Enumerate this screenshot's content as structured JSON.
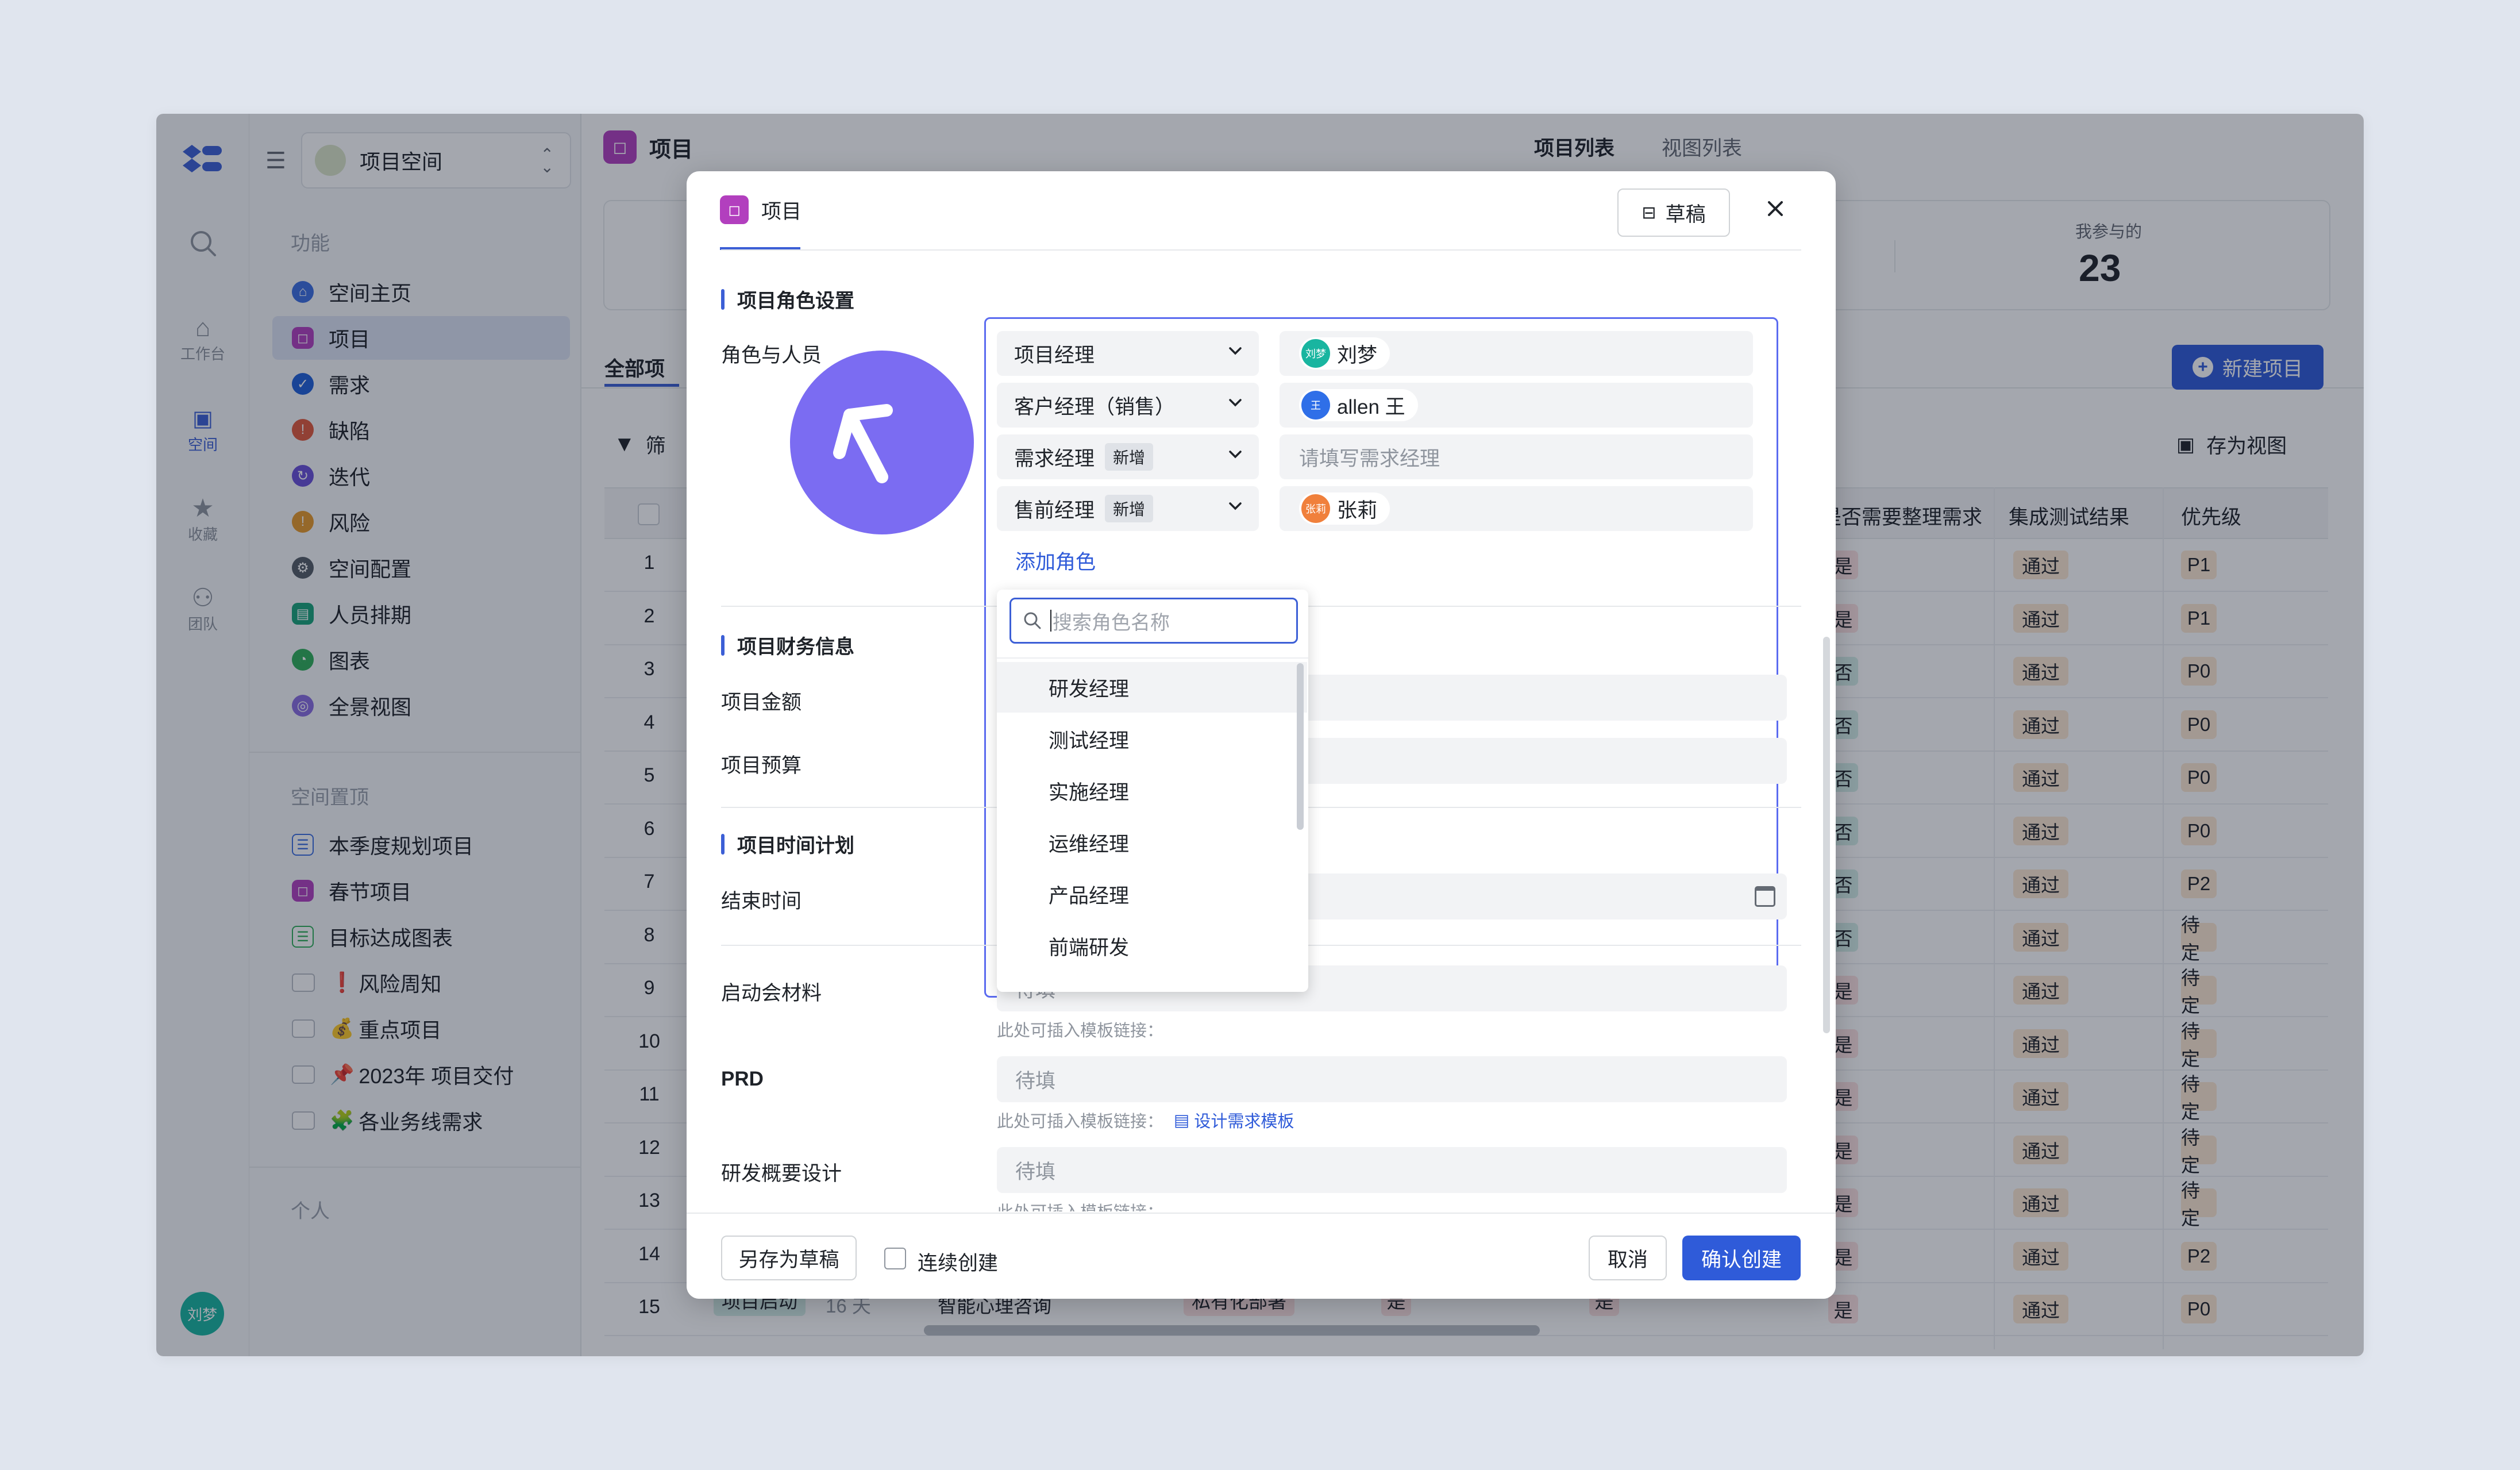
{
  "app": {
    "rail": {
      "items": [
        {
          "label": "工作台"
        },
        {
          "label": "空间"
        },
        {
          "label": "收藏"
        },
        {
          "label": "团队"
        }
      ],
      "avatar": "刘梦"
    },
    "space_selector": {
      "label": "项目空间"
    },
    "sidebar": {
      "section_functions": "功能",
      "items": [
        {
          "label": "空间主页",
          "color": "#3c6fe0"
        },
        {
          "label": "项目",
          "color": "#b23fbe"
        },
        {
          "label": "需求",
          "color": "#1f5fd8"
        },
        {
          "label": "缺陷",
          "color": "#e05a3c"
        },
        {
          "label": "迭代",
          "color": "#6a4fd8"
        },
        {
          "label": "风险",
          "color": "#e79a2b"
        },
        {
          "label": "空间配置",
          "color": "#555c66"
        },
        {
          "label": "人员排期",
          "color": "#19a37a"
        },
        {
          "label": "图表",
          "color": "#2fae59"
        },
        {
          "label": "全景视图",
          "color": "#8a6de0"
        }
      ],
      "section_pinned": "空间置顶",
      "pinned": [
        {
          "label": "本季度规划项目"
        },
        {
          "label": "春节项目"
        },
        {
          "label": "目标达成图表"
        },
        {
          "label": "风险周知",
          "emoji": "❗"
        },
        {
          "label": "重点项目",
          "emoji": "💰"
        },
        {
          "label": "2023年 项目交付",
          "emoji": "📌"
        },
        {
          "label": "各业务线需求",
          "emoji": "🧩"
        }
      ],
      "section_personal": "个人"
    }
  },
  "page": {
    "title": "项目",
    "tabs": [
      "项目列表",
      "视图列表"
    ],
    "stat_label": "我参与的",
    "stat_value": "23",
    "new_button": "新建项目",
    "all_tab": "全部项",
    "filter": "筛",
    "save_view": "存为视图",
    "columns": [
      "是否需要整理需求",
      "集成测试结果",
      "优先级"
    ],
    "rows": [
      {
        "n": "1",
        "need": "是",
        "test": "通过",
        "pri": "P1"
      },
      {
        "n": "2",
        "need": "是",
        "test": "通过",
        "pri": "P1"
      },
      {
        "n": "3",
        "need": "否",
        "test": "通过",
        "pri": "P0"
      },
      {
        "n": "4",
        "need": "否",
        "test": "通过",
        "pri": "P0"
      },
      {
        "n": "5",
        "need": "否",
        "test": "通过",
        "pri": "P0"
      },
      {
        "n": "6",
        "need": "否",
        "test": "通过",
        "pri": "P0"
      },
      {
        "n": "7",
        "need": "否",
        "test": "通过",
        "pri": "P2"
      },
      {
        "n": "8",
        "need": "否",
        "test": "通过",
        "pri": "待定"
      },
      {
        "n": "9",
        "need": "是",
        "test": "通过",
        "pri": "待定"
      },
      {
        "n": "10",
        "need": "是",
        "test": "通过",
        "pri": "待定"
      },
      {
        "n": "11",
        "need": "是",
        "test": "通过",
        "pri": "待定"
      },
      {
        "n": "12",
        "need": "是",
        "test": "通过",
        "pri": "待定"
      },
      {
        "n": "13",
        "need": "是",
        "test": "通过",
        "pri": "待定"
      },
      {
        "n": "14",
        "need": "是",
        "test": "通过",
        "pri": "P2"
      },
      {
        "n": "15",
        "need": "是",
        "test": "通过",
        "pri": "P0"
      }
    ],
    "last_row": {
      "stage": "项目启动",
      "days": "16 天",
      "name": "智能心理咨询",
      "deploy": "私有化部署",
      "c1": "是",
      "c2": "是"
    }
  },
  "modal": {
    "tab": "项目",
    "draft_button": "草稿",
    "section_roles": "项目角色设置",
    "roles_label": "角色与人员",
    "roles": [
      {
        "role": "项目经理",
        "new": "",
        "person": "刘梦",
        "avatar": "刘梦",
        "avatar_color": "#19b5a0"
      },
      {
        "role": "客户经理（销售）",
        "new": "",
        "person": "allen 王",
        "avatar": "王",
        "avatar_color": "#2f6fe8"
      },
      {
        "role": "需求经理",
        "new": "新增",
        "person": "",
        "placeholder": "请填写需求经理"
      },
      {
        "role": "售前经理",
        "new": "新增",
        "person": "张莉",
        "avatar": "张莉",
        "avatar_color": "#f0803c"
      }
    ],
    "add_role": "添加角色",
    "search_placeholder": "搜索角色名称",
    "dropdown": [
      "研发经理",
      "测试经理",
      "实施经理",
      "运维经理",
      "产品经理",
      "前端研发"
    ],
    "section_finance": "项目财务信息",
    "amount_label": "项目金额",
    "budget_label": "项目预算",
    "section_time": "项目时间计划",
    "end_label": "结束时间",
    "kickoff_label": "启动会材料",
    "kickoff_value": "待填",
    "hint": "此处可插入模板链接：",
    "prd_label": "PRD",
    "prd_value": "待填",
    "template_link": "设计需求模板",
    "design_label": "研发概要设计",
    "design_value": "待填",
    "save_draft": "另存为草稿",
    "continue": "连续创建",
    "cancel": "取消",
    "confirm": "确认创建"
  },
  "colors": {
    "accent": "#2f5bd9",
    "cursor": "#7b6cf2"
  }
}
